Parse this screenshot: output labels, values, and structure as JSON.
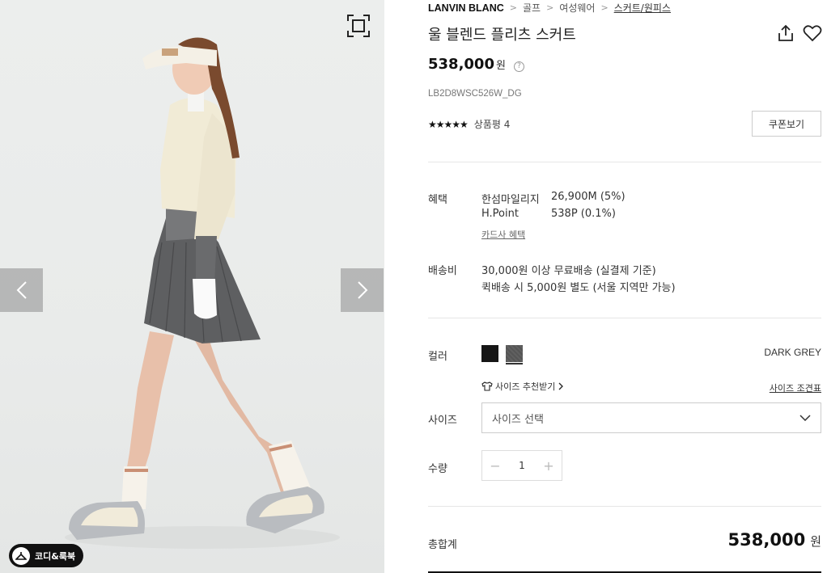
{
  "gallery": {
    "prev_icon": "chevron-left-icon",
    "next_icon": "chevron-right-icon",
    "zoom_icon": "fullscreen-icon",
    "coordi_label": "코디&룩북"
  },
  "breadcrumb": {
    "brand": "LANVIN BLANC",
    "items": [
      "골프",
      "여성웨어",
      "스커트/원피스"
    ]
  },
  "product": {
    "title": "울 블렌드 플리츠 스커트",
    "price": "538,000",
    "price_unit": "원",
    "sku": "LB2D8WSC526W_DG",
    "stars": "★★★★★",
    "review_label": "상품평 4",
    "coupon_button": "쿠폰보기"
  },
  "benefits": {
    "label": "혜택",
    "rows": [
      {
        "name": "한섬마일리지",
        "value": "26,900M (5%)"
      },
      {
        "name": "H.Point",
        "value": "538P (0.1%)"
      }
    ],
    "card_link": "카드사 혜택"
  },
  "shipping": {
    "label": "배송비",
    "line1": "30,000원 이상 무료배송 (실결제 기준)",
    "line2": "퀵배송 시 5,000원 별도 (서울 지역만 가능)"
  },
  "color": {
    "label": "컬러",
    "selected_name": "DARK GREY",
    "swatches": [
      "#161616",
      "#5a5a5a"
    ]
  },
  "size": {
    "recommend": "사이즈 추천받기",
    "chart_link": "사이즈 조견표",
    "label": "사이즈",
    "placeholder": "사이즈 선택"
  },
  "quantity": {
    "label": "수량",
    "value": "1",
    "minus": "−",
    "plus": "+"
  },
  "total": {
    "label": "총합계",
    "price": "538,000",
    "unit": "원"
  }
}
